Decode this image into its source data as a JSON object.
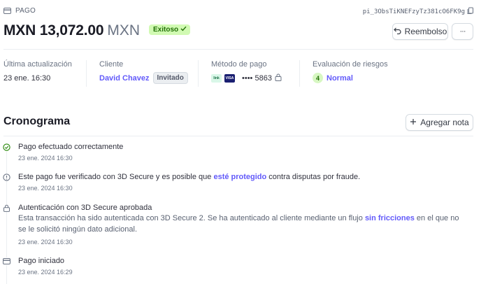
{
  "header": {
    "kind_label": "PAGO",
    "payment_id": "pi_3ObsTiKNEFzyTz381cO6FK9g",
    "amount": "MXN 13,072.00",
    "currency": "MXN",
    "status_badge": "Exitoso",
    "refund_label": "Reembolso",
    "more_label": "···"
  },
  "summary": {
    "last_update": {
      "label": "Última actualización",
      "value": "23 ene. 16:30"
    },
    "customer": {
      "label": "Cliente",
      "name": "David Chavez",
      "tag": "Invitado"
    },
    "payment_method": {
      "label": "Método de pago",
      "brand_a": "link",
      "brand_b": "VISA",
      "masked": "•••• 5863"
    },
    "risk": {
      "label": "Evaluación de riesgos",
      "score": "4",
      "level": "Normal"
    }
  },
  "timeline": {
    "title": "Cronograma",
    "add_note_label": "Agregar nota",
    "events": [
      {
        "title": "Pago efectuado correctamente",
        "time": "23 ene. 2024 16:30"
      },
      {
        "title_pre": "Este pago fue verificado con 3D Secure y es posible que ",
        "title_link": "esté protegido",
        "title_post": " contra disputas por fraude.",
        "time": "23 ene. 2024 16:30"
      },
      {
        "title": "Autenticación con 3D Secure aprobada",
        "desc_pre": "Esta transacción ha sido autenticada con 3D Secure 2. Se ha autenticado al cliente mediante un flujo ",
        "desc_link": "sin fricciones",
        "desc_post": " en el que no se le solicitó ningún dato adicional.",
        "time": "23 ene. 2024 16:30"
      },
      {
        "title": "Pago iniciado",
        "time": "23 ene. 2024 16:29"
      }
    ]
  },
  "colors": {
    "accent": "#625afa",
    "success_bg": "#d1fab3",
    "success_text": "#217005"
  }
}
